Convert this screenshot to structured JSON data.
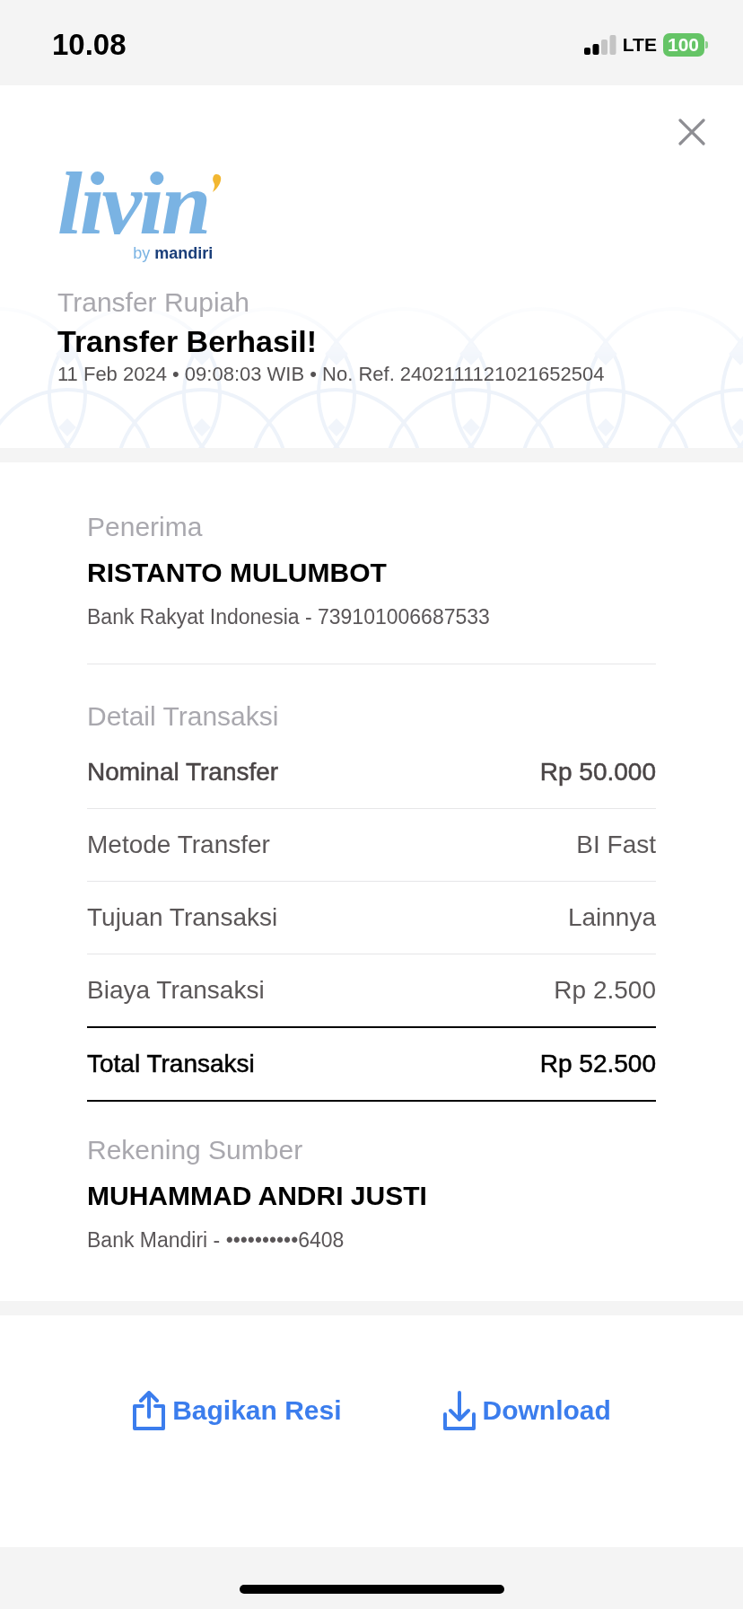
{
  "status_bar": {
    "time": "10.08",
    "network": "LTE",
    "battery": "100"
  },
  "header": {
    "logo": {
      "wordmark": "livin",
      "tagline": "by **mandiri**"
    },
    "category": "Transfer Rupiah",
    "title": "Transfer Berhasil!",
    "meta": "11 Feb 2024 • 09:08:03 WIB • No. Ref. 2402111121021652504"
  },
  "recipient": {
    "section": "Penerima",
    "name": "RISTANTO MULUMBOT",
    "account": "Bank Rakyat Indonesia - 739101006687533"
  },
  "details": {
    "section": "Detail Transaksi",
    "rows": [
      {
        "label": "Nominal Transfer",
        "value": "Rp 50.000",
        "kind": "highlight"
      },
      {
        "label": "Metode Transfer",
        "value": "BI Fast",
        "kind": "plain"
      },
      {
        "label": "Tujuan Transaksi",
        "value": "Lainnya",
        "kind": "plain"
      },
      {
        "label": "Biaya Transaksi",
        "value": "Rp 2.500",
        "kind": "plain"
      },
      {
        "label": "Total Transaksi",
        "value": "Rp 52.500",
        "kind": "total"
      }
    ]
  },
  "source": {
    "section": "Rekening Sumber",
    "name": "MUHAMMAD ANDRI JUSTI",
    "account": "Bank Mandiri - ••••••••••6408"
  },
  "actions": [
    {
      "label": "Bagikan Resi",
      "kind": "share"
    },
    {
      "label": "Download",
      "kind": "download"
    }
  ]
}
